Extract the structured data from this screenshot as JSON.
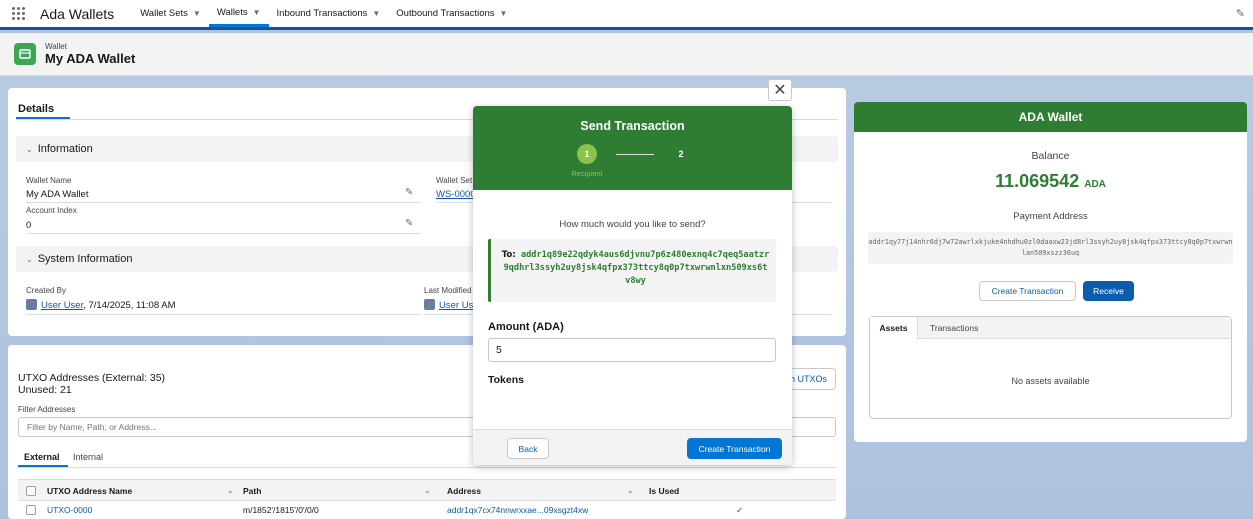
{
  "app": {
    "name": "Ada Wallets",
    "nav": [
      {
        "label": "Wallet Sets"
      },
      {
        "label": "Wallets"
      },
      {
        "label": "Inbound Transactions"
      },
      {
        "label": "Outbound Transactions"
      }
    ]
  },
  "header": {
    "object_label": "Wallet",
    "title": "My ADA Wallet"
  },
  "details": {
    "tab_label": "Details",
    "information_section": "Information",
    "wallet_name_label": "Wallet Name",
    "wallet_name_value": "My ADA Wallet",
    "wallet_set_label": "Wallet Set",
    "wallet_set_value": "WS-0000",
    "account_index_label": "Account Index",
    "account_index_value": "0",
    "system_section": "System Information",
    "created_by_label": "Created By",
    "created_by_user": "User User",
    "created_by_date": ", 7/14/2025, 11:08 AM",
    "last_modified_label": "Last Modified By",
    "last_modified_user": "User User"
  },
  "utxo": {
    "title_line1": "UTXO Addresses (External: 35)",
    "title_line2": "Unused: 21",
    "button_label": "Refresh UTXOs",
    "filter_label": "Filter Addresses",
    "filter_placeholder": "Filter by Name, Path, or Address...",
    "tab_external": "External",
    "tab_internal": "Internal",
    "columns": [
      "UTXO Address Name",
      "Path",
      "Address",
      "Is Used"
    ],
    "rows": [
      {
        "name": "UTXO-0000",
        "path": "m/1852'/1815'/0'/0/0",
        "address": "addr1qx7cx74nnwrxxae...09xsgzt4xw",
        "used": "✓"
      }
    ]
  },
  "wallet_card": {
    "title": "ADA Wallet",
    "balance_label": "Balance",
    "balance_value": "11.069542",
    "balance_unit": "ADA",
    "payment_address_label": "Payment Address",
    "payment_address": "addr1qy77j14nhr6dj7w72awrlxkjuke4nhdhu0zl0daaxw23jd8rl3ssyh2uy8jsk4qfpx373ttcy8q0p7txwrwnlan509xszz36uq",
    "create_button": "Create Transaction",
    "receive_button": "Receive",
    "tab_assets": "Assets",
    "tab_transactions": "Transactions",
    "empty_message": "No assets available"
  },
  "modal": {
    "title": "Send Transaction",
    "step1": "1",
    "step2": "2",
    "step1_label": "Recipient",
    "question": "How much would you like to send?",
    "to_label": "To:",
    "to_address": "addr1q89e22qdyk4aus6djvnu7p6z480exnq4c7qeq5aatzr9qdhrl3ssyh2uy8jsk4qfpx373ttcy8q0p7txwrwnlxn509xs6tv8wy",
    "amount_label": "Amount (ADA)",
    "amount_value": "5",
    "tokens_label": "Tokens",
    "back_button": "Back",
    "create_button": "Create Transaction"
  },
  "colors": {
    "brand_green": "#2e7d32",
    "step_green": "#8bc34a",
    "primary_blue": "#0176d3",
    "nav_blue": "#1b5297"
  }
}
